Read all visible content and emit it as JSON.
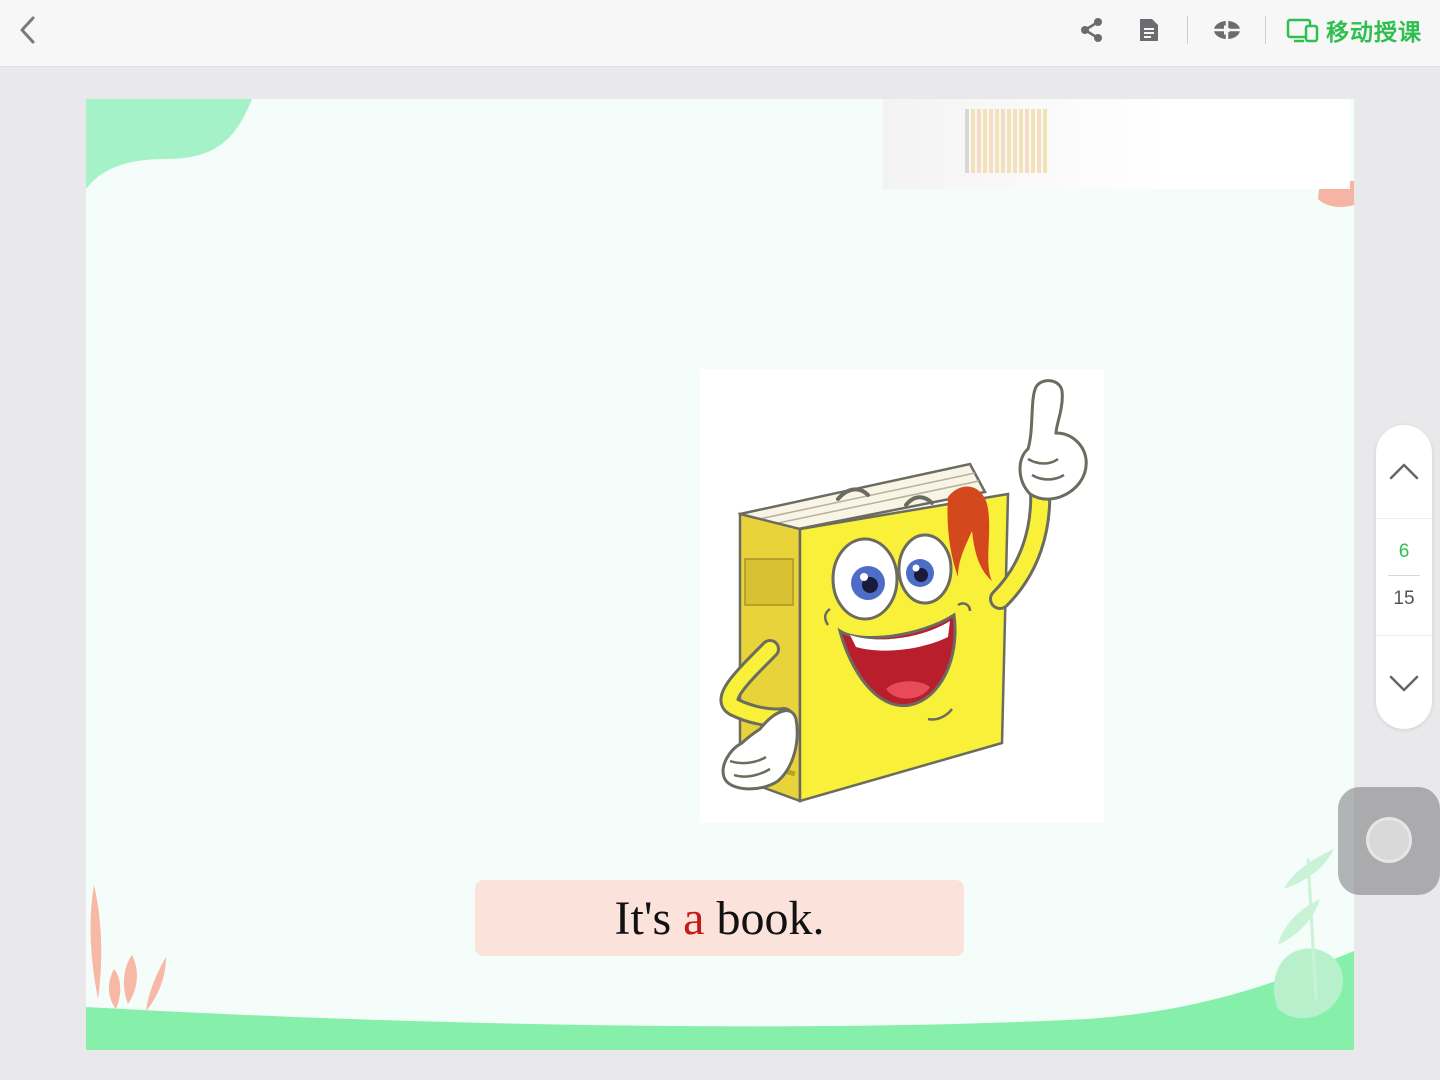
{
  "topbar": {
    "back_icon": "chevron-left-icon",
    "tools": [
      {
        "name": "share",
        "icon": "share-icon"
      },
      {
        "name": "document",
        "icon": "document-icon"
      },
      {
        "name": "pointer",
        "icon": "laser-pointer-icon"
      }
    ],
    "mobile_teach_label": "移动授课",
    "accent_color": "#2fbf4f"
  },
  "slide": {
    "caption_before": "It's ",
    "caption_highlight": "a",
    "caption_after": " book.",
    "highlight_color": "#c41a1a",
    "caption_bg": "#fbe3dc",
    "image": "cartoon-book-character"
  },
  "pager": {
    "current_page": "6",
    "total_pages": "15",
    "up_icon": "chevron-up-icon",
    "down_icon": "chevron-down-icon",
    "current_color": "#2fbf4f"
  }
}
